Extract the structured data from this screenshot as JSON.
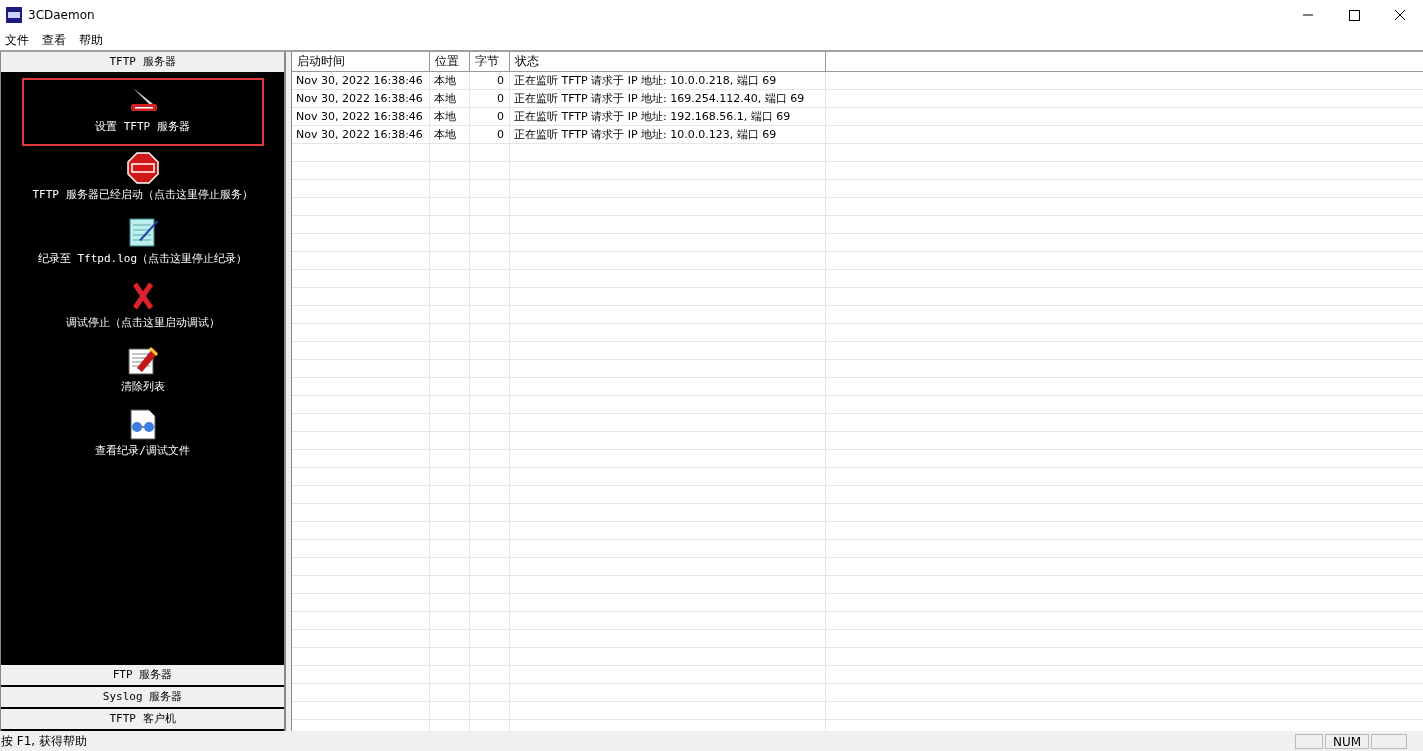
{
  "window": {
    "title": "3CDaemon"
  },
  "menu": [
    "文件",
    "查看",
    "帮助"
  ],
  "sidebar": {
    "header": "TFTP 服务器",
    "items": [
      {
        "kind": "knife",
        "label": "设置 TFTP 服务器",
        "highlighted": true
      },
      {
        "kind": "stop",
        "label": "TFTP 服务器已经启动（点击这里停止服务）",
        "highlighted": false
      },
      {
        "kind": "notepad",
        "label": "纪录至 Tftpd.log（点击这里停止纪录）",
        "highlighted": false
      },
      {
        "kind": "cross",
        "label": "调试停止（点击这里启动调试）",
        "highlighted": false
      },
      {
        "kind": "eraser",
        "label": "清除列表",
        "highlighted": false
      },
      {
        "kind": "glasses",
        "label": "查看纪录/调试文件",
        "highlighted": false
      }
    ],
    "sections": [
      "FTP 服务器",
      "Syslog 服务器",
      "TFTP 客户机"
    ]
  },
  "table": {
    "columns": [
      "启动时间",
      "位置",
      "字节",
      "状态"
    ],
    "rows": [
      [
        "Nov 30, 2022 16:38:46",
        "本地",
        "0",
        "正在监听 TFTP 请求于 IP 地址: 10.0.0.218, 端口 69"
      ],
      [
        "Nov 30, 2022 16:38:46",
        "本地",
        "0",
        "正在监听 TFTP 请求于 IP 地址: 169.254.112.40, 端口 69"
      ],
      [
        "Nov 30, 2022 16:38:46",
        "本地",
        "0",
        "正在监听 TFTP 请求于 IP 地址: 192.168.56.1, 端口 69"
      ],
      [
        "Nov 30, 2022 16:38:46",
        "本地",
        "0",
        "正在监听 TFTP 请求于 IP 地址: 10.0.0.123, 端口 69"
      ]
    ]
  },
  "status_bar": {
    "message": "按 F1, 获得帮助",
    "indicator": "NUM"
  }
}
